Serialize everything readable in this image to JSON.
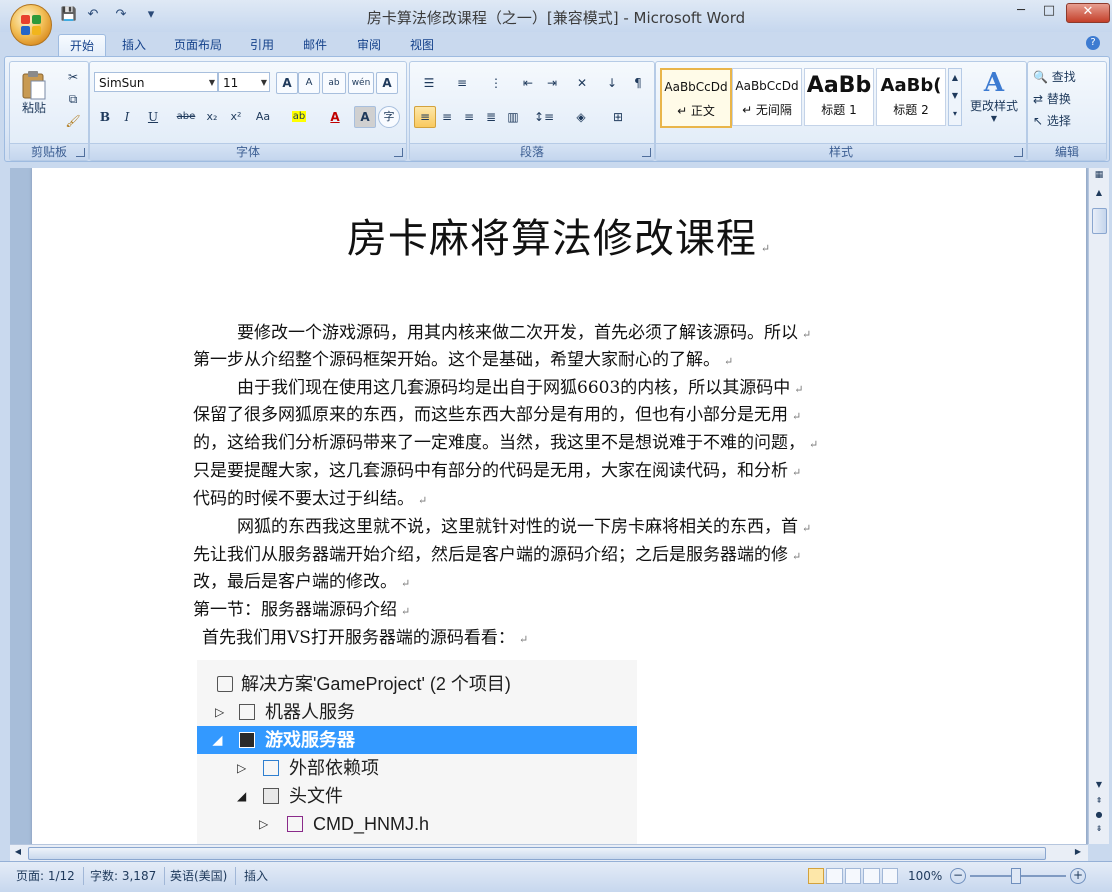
{
  "window": {
    "title": "房卡算法修改课程（之一）[兼容模式] - Microsoft Word",
    "minimize": "─",
    "maximize": "□",
    "close": "✕"
  },
  "quick_access": [
    "💾",
    "↶",
    "↷",
    "▾"
  ],
  "tabs": [
    "开始",
    "插入",
    "页面布局",
    "引用",
    "邮件",
    "审阅",
    "视图"
  ],
  "ribbon": {
    "clipboard": {
      "label": "剪贴板",
      "paste": "粘贴"
    },
    "font": {
      "label": "字体",
      "font_name": "SimSun",
      "font_size": "11",
      "grow": "A",
      "shrink": "A",
      "phonetic": "wén",
      "char_border": "A",
      "bold": "B",
      "italic": "I",
      "underline": "U",
      "strike": "abe",
      "subscript": "x₂",
      "superscript": "x²",
      "case": "Aa",
      "highlight": "ab",
      "font_color": "A",
      "shading": "A",
      "enclose": "字"
    },
    "paragraph": {
      "label": "段落"
    },
    "styles": {
      "label": "样式",
      "items": [
        {
          "sample": "AaBbCcDd",
          "name": "↵ 正文"
        },
        {
          "sample": "AaBbCcDd",
          "name": "↵ 无间隔"
        },
        {
          "sample": "AaBb",
          "name": "标题 1"
        },
        {
          "sample": "AaBb(",
          "name": "标题 2"
        }
      ],
      "change_styles": "更改样式"
    },
    "editing": {
      "label": "编辑",
      "find": "查找",
      "replace": "替换",
      "select": "选择"
    }
  },
  "document": {
    "title": "房卡麻将算法修改课程",
    "lines": [
      "要修改一个游戏源码，用其内核来做二次开发，首先必须了解该源码。所以",
      "第一步从介绍整个源码框架开始。这个是基础，希望大家耐心的了解。",
      "由于我们现在使用这几套源码均是出自于网狐6603的内核，所以其源码中",
      "保留了很多网狐原来的东西，而这些东西大部分是有用的，但也有小部分是无用",
      "的，这给我们分析源码带来了一定难度。当然，我这里不是想说难于不难的问题，",
      "只是要提醒大家，这几套源码中有部分的代码是无用，大家在阅读代码，和分析",
      "代码的时候不要太过于纠结。",
      "网狐的东西我这里就不说，这里就针对性的说一下房卡麻将相关的东西，首",
      "先让我们从服务器端开始介绍，然后是客户端的源码介绍；之后是服务器端的修",
      "改，最后是客户端的修改。",
      "第一节：服务器端源码介绍",
      "首先我们用VS打开服务器端的源码看看："
    ],
    "paragraph_mark": "↵",
    "solution_explorer": [
      "解决方案'GameProject' (2 个项目)",
      "机器人服务",
      "游戏服务器",
      "外部依赖项",
      "头文件",
      "CMD_HNMJ.h"
    ]
  },
  "statusbar": {
    "page": "页面: 1/12",
    "words": "字数: 3,187",
    "language": "英语(美国)",
    "mode": "插入",
    "zoom": "100%"
  },
  "colors": {
    "accent": "#3399ff",
    "ribbon_bg": "#dbe7f6",
    "frame_bg": "#c9d9ee"
  }
}
